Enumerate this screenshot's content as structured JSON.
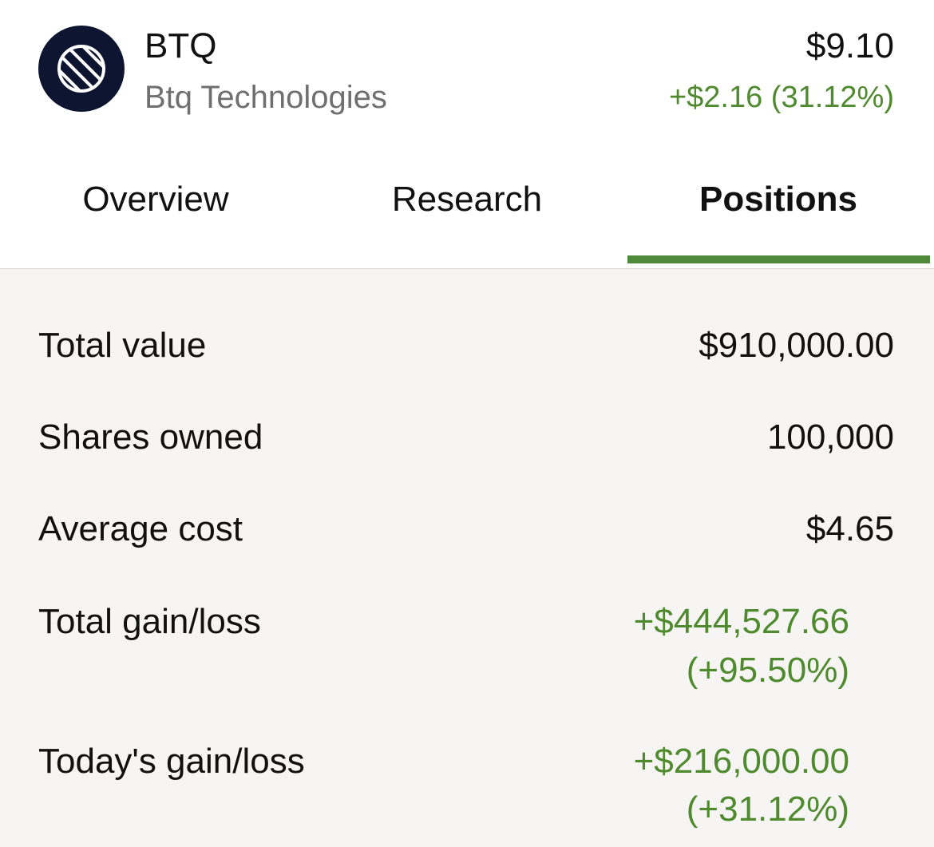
{
  "header": {
    "logo_icon": "globe-stripes-icon",
    "ticker": "BTQ",
    "company": "Btq Technologies",
    "price": "$9.10",
    "change": "+$2.16 (31.12%)"
  },
  "tabs": [
    {
      "label": "Overview",
      "active": false
    },
    {
      "label": "Research",
      "active": false
    },
    {
      "label": "Positions",
      "active": true
    }
  ],
  "positions": {
    "total_value": {
      "label": "Total value",
      "value": "$910,000.00"
    },
    "shares_owned": {
      "label": "Shares owned",
      "value": "100,000"
    },
    "average_cost": {
      "label": "Average cost",
      "value": "$4.65"
    },
    "total_gain": {
      "label": "Total gain/loss",
      "amount": "+$444,527.66",
      "percent": "(+95.50%)"
    },
    "today_gain": {
      "label": "Today's gain/loss",
      "amount": "+$216,000.00",
      "percent": "(+31.12%)"
    }
  },
  "colors": {
    "gain_green": "#4f8a2e",
    "tab_underline": "#4f8a3a",
    "logo_background": "#0e1530",
    "content_background": "#f6f5f3"
  }
}
